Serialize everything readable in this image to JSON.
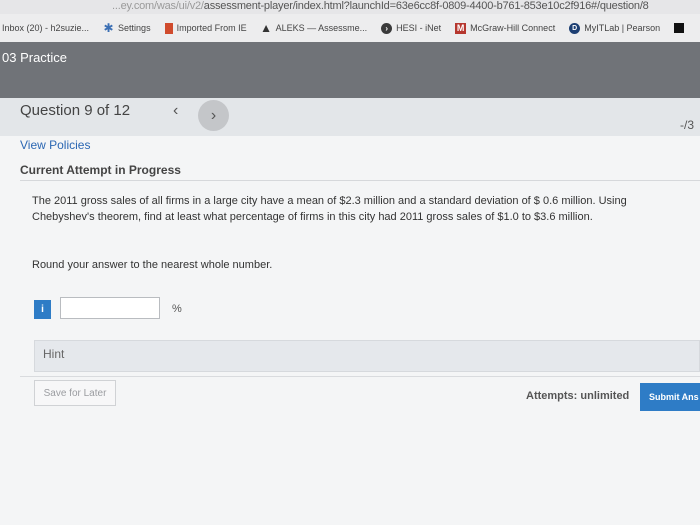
{
  "browser": {
    "url_prefix": "...ey.com/was/ui/v2/",
    "url": "assessment-player/index.html?launchId=63e6cc8f-0809-4400-b761-853e10c2f916#/question/8",
    "bookmarks": [
      {
        "label": "Inbox (20) - h2suzie...",
        "icon": "none"
      },
      {
        "label": "Settings",
        "icon": "gear-icon"
      },
      {
        "label": "Imported From IE",
        "icon": "book-icon"
      },
      {
        "label": "ALEKS — Assessme...",
        "icon": "aleks-icon"
      },
      {
        "label": "HESI - iNet",
        "icon": "hesi-icon"
      },
      {
        "label": "McGraw-Hill Connect",
        "icon": "mcgraw-hill-icon"
      },
      {
        "label": "MyITLab | Pearson",
        "icon": "mylab-icon"
      }
    ]
  },
  "header": {
    "title": "03 Practice"
  },
  "question": {
    "label": "Question 9 of 12",
    "score": "-/3",
    "view_policies": "View Policies",
    "attempt_status": "Current Attempt in Progress",
    "text": "The 2011 gross sales of all firms in a large city have a mean of $2.3 million and a standard deviation of $ 0.6 million. Using Chebyshev's theorem, find at least what percentage of firms in this city had 2011 gross sales of $1.0 to $3.6 million.",
    "instruction": "Round your answer to the nearest whole number.",
    "info_badge": "i",
    "answer_value": "",
    "unit": "%",
    "hint_label": "Hint"
  },
  "footer": {
    "save_label": "Save for Later",
    "attempts_label": "Attempts: unlimited",
    "submit_label": "Submit Ans"
  },
  "colors": {
    "accent": "#2e7cc6",
    "header_band": "#707378",
    "link": "#2b67b3"
  }
}
